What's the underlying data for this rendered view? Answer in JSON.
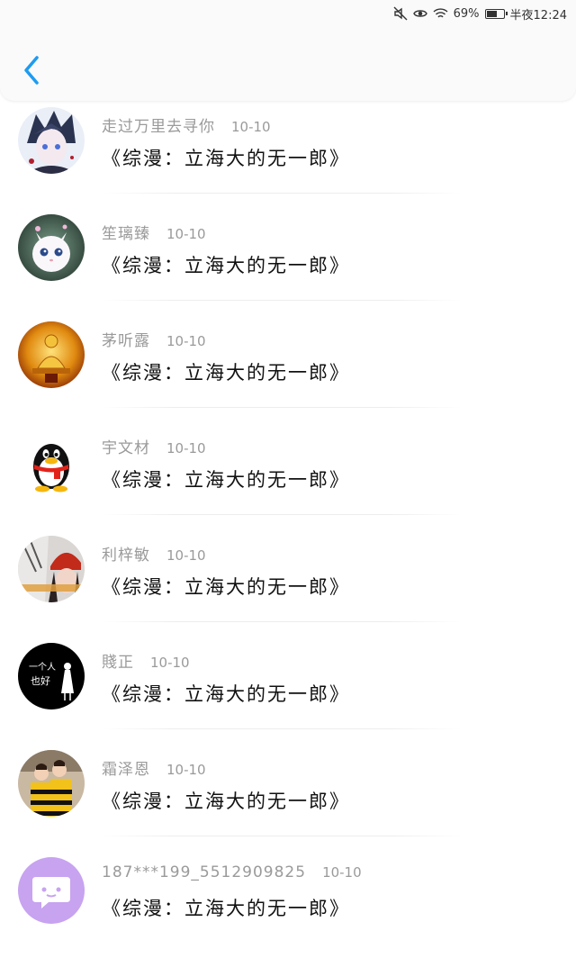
{
  "status_bar": {
    "battery_percent_text": "69%",
    "battery_level": 0.69,
    "time": "半夜12:24",
    "icons": [
      "mute-icon",
      "eye-icon",
      "wifi-icon",
      "battery-icon"
    ]
  },
  "header": {
    "back_icon": "chevron-left-icon",
    "accent_color": "#1e9bf0"
  },
  "comments": [
    {
      "name": "走过万里去寻你",
      "date": "10-10",
      "text": "《综漫：立海大的无一郎》",
      "avatar": "anime-boy-avatar"
    },
    {
      "name": "笙璃臻",
      "date": "10-10",
      "text": "《综漫：立海大的无一郎》",
      "avatar": "white-kitten-avatar"
    },
    {
      "name": "茅听露",
      "date": "10-10",
      "text": "《综漫：立海大的无一郎》",
      "avatar": "golden-buddha-avatar"
    },
    {
      "name": "宇文材",
      "date": "10-10",
      "text": "《综漫：立海大的无一郎》",
      "avatar": "qq-penguin-avatar"
    },
    {
      "name": "利梓敏",
      "date": "10-10",
      "text": "《综漫：立海大的无一郎》",
      "avatar": "girl-red-hat-avatar"
    },
    {
      "name": "賤正",
      "date": "10-10",
      "text": "《综漫：立海大的无一郎》",
      "avatar": "black-text-avatar"
    },
    {
      "name": "霜泽恩",
      "date": "10-10",
      "text": "《综漫：立海大的无一郎》",
      "avatar": "couple-photo-avatar"
    },
    {
      "name": "187***199_5512909825",
      "date": "10-10",
      "text": "《综漫：立海大的无一郎》",
      "avatar": "default-chat-avatar"
    }
  ],
  "avatar_texts": {
    "black_text": [
      "一个人",
      "也好"
    ]
  }
}
